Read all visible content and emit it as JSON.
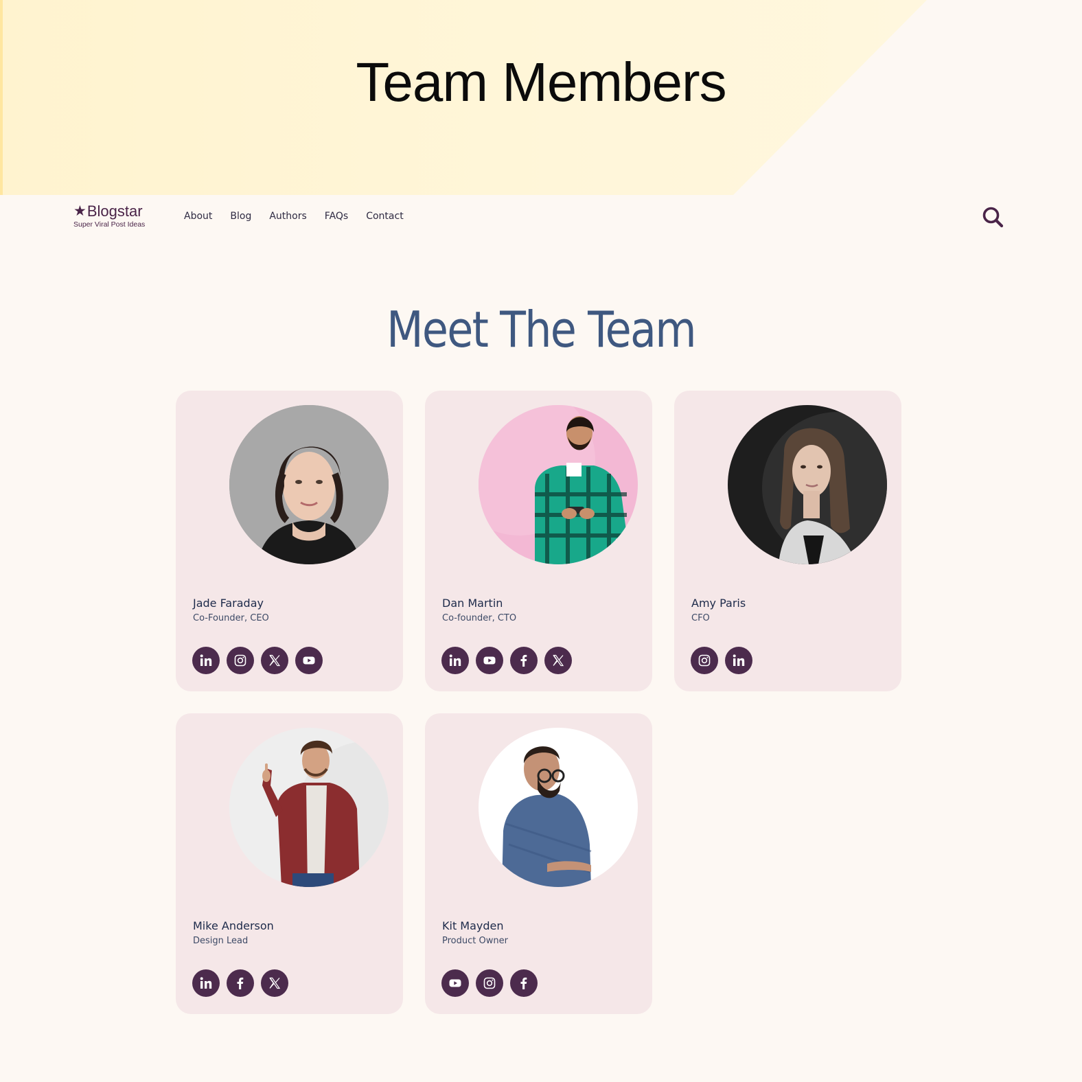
{
  "banner": {
    "title": "Team Members"
  },
  "logo": {
    "name": "Blogstar",
    "star": "★",
    "tagline": "Super Viral Post Ideas"
  },
  "nav": {
    "items": [
      "About",
      "Blog",
      "Authors",
      "FAQs",
      "Contact"
    ]
  },
  "search": {
    "icon": "search-icon"
  },
  "heading": "Meet The Team",
  "colors": {
    "page_bg": "#fdf8f3",
    "banner_yellow": "#fff6d6",
    "card_bg": "#f5e7e8",
    "social_bg": "#4c2b4d",
    "heading": "#3f5880",
    "brand": "#4a2448"
  },
  "members": [
    {
      "name": "Jade Faraday",
      "role": "Co-Founder, CEO",
      "socials": [
        "linkedin",
        "instagram",
        "x",
        "youtube"
      ]
    },
    {
      "name": "Dan Martin",
      "role": "Co-founder, CTO",
      "socials": [
        "linkedin",
        "youtube",
        "facebook",
        "x"
      ]
    },
    {
      "name": "Amy Paris",
      "role": "CFO",
      "socials": [
        "instagram",
        "linkedin"
      ]
    },
    {
      "name": "Mike Anderson",
      "role": "Design Lead",
      "socials": [
        "linkedin",
        "facebook",
        "x"
      ]
    },
    {
      "name": "Kit Mayden",
      "role": "Product Owner",
      "socials": [
        "youtube",
        "instagram",
        "facebook"
      ]
    }
  ]
}
